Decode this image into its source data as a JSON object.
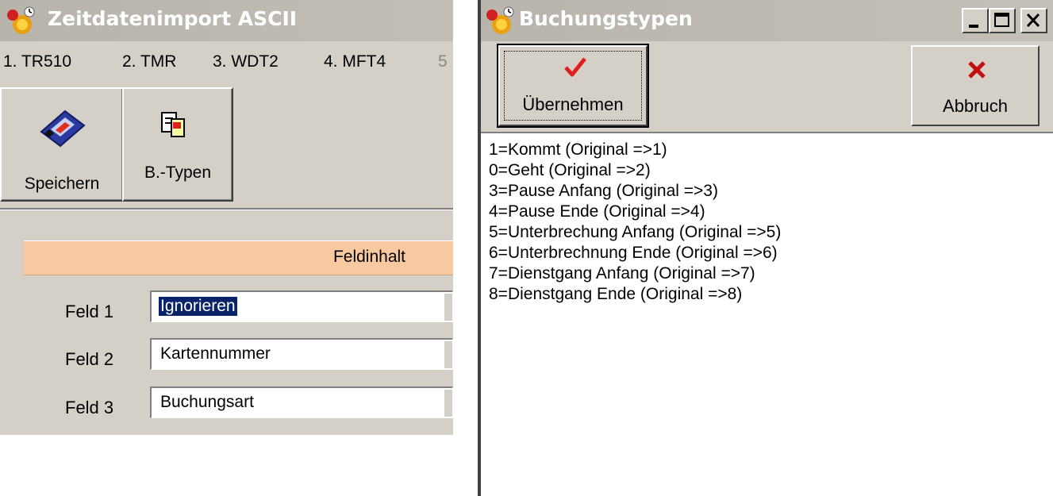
{
  "left_window": {
    "title": "Zeitdatenimport ASCII",
    "tabs": [
      "1. TR510",
      "2. TMR",
      "3. WDT2",
      "4. MFT4",
      "5"
    ],
    "toolbar": {
      "save_label": "Speichern",
      "types_label": "B.-Typen"
    },
    "grid": {
      "header": "Feldinhalt",
      "rows": [
        {
          "label": "Feld 1",
          "value": "Ignorieren"
        },
        {
          "label": "Feld 2",
          "value": "Kartennummer"
        },
        {
          "label": "Feld 3",
          "value": "Buchungsart"
        }
      ]
    }
  },
  "right_window": {
    "title": "Buchungstypen",
    "buttons": {
      "ok_label": "Übernehmen",
      "cancel_label": "Abbruch"
    },
    "list_items": [
      "1=Kommt (Original =>1)",
      "0=Geht (Original =>2)",
      "3=Pause Anfang (Original =>3)",
      "4=Pause Ende (Original =>4)",
      "5=Unterbrechung Anfang (Original =>5)",
      "6=Unterbrechnung Ende (Original =>6)",
      "7=Dienstgang Anfang (Original =>7)",
      "8=Dienstgang Ende (Original =>8)"
    ]
  },
  "colors": {
    "header_accent": "#f8c8a0",
    "selection": "#0a246a",
    "check_red": "#e0201a",
    "window_face": "#d4d0c8"
  },
  "icons": [
    "app-icon",
    "floppy-disk-icon",
    "booking-types-icon",
    "checkmark-icon",
    "cancel-x-icon",
    "minimize-icon",
    "maximize-icon",
    "close-icon"
  ]
}
